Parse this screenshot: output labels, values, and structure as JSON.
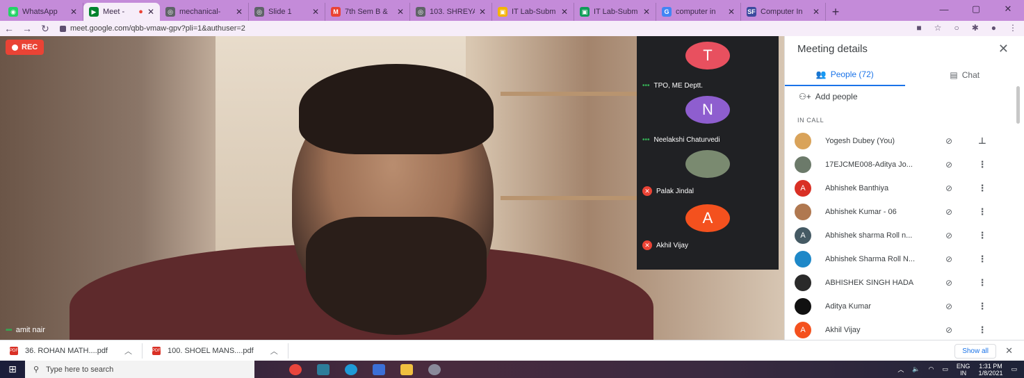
{
  "browser": {
    "tabs": [
      {
        "title": "WhatsApp",
        "color": "#25d366",
        "glyph": "◉"
      },
      {
        "title": "Meet - ",
        "color": "#00832d",
        "glyph": "▶",
        "active": true,
        "recording": true
      },
      {
        "title": "mechanical-",
        "color": "#5f6368",
        "glyph": "◎"
      },
      {
        "title": "Slide 1",
        "color": "#5f6368",
        "glyph": "◎"
      },
      {
        "title": "7th Sem B &",
        "color": "#ea4335",
        "glyph": "M"
      },
      {
        "title": "103. SHREYA",
        "color": "#5f6368",
        "glyph": "◎"
      },
      {
        "title": "IT Lab-Subm",
        "color": "#f4b400",
        "glyph": "▣"
      },
      {
        "title": "IT Lab-Subm",
        "color": "#0f9d58",
        "glyph": "▣"
      },
      {
        "title": "computer in",
        "color": "#4285f4",
        "glyph": "G"
      },
      {
        "title": "Computer In",
        "color": "#3c4a9e",
        "glyph": "SF"
      }
    ],
    "url": "meet.google.com/qbb-vmaw-gpv?pli=1&authuser=2"
  },
  "meet": {
    "rec_label": "REC",
    "main_speaker": "amit nair",
    "tiles": [
      {
        "name": "TPO, ME Deptt.",
        "initial": "T",
        "color": "#e8505f",
        "state": "talking"
      },
      {
        "name": "Neelakshi Chaturvedi",
        "initial": "N",
        "color": "#8e5ecf",
        "state": "talking"
      },
      {
        "name": "Palak Jindal",
        "initial": "",
        "color": "#7a8a70",
        "state": "muted"
      },
      {
        "name": "Akhil Vijay",
        "initial": "A",
        "color": "#f4511e",
        "state": "muted"
      }
    ]
  },
  "panel": {
    "title": "Meeting details",
    "tab_people": "People (72)",
    "tab_chat": "Chat",
    "add_people": "Add people",
    "in_call": "IN CALL",
    "people": [
      {
        "name": "Yogesh Dubey (You)",
        "initial": "",
        "color": "#d9a35a",
        "action": "pin"
      },
      {
        "name": "17EJCME008-Aditya Jo...",
        "initial": "",
        "color": "#6c7a6a",
        "action": "more"
      },
      {
        "name": "Abhishek Banthiya",
        "initial": "A",
        "color": "#d93025",
        "action": "more"
      },
      {
        "name": "Abhishek Kumar - 06",
        "initial": "",
        "color": "#b07850",
        "action": "more"
      },
      {
        "name": "Abhishek sharma Roll n...",
        "initial": "A",
        "color": "#455a64",
        "action": "more"
      },
      {
        "name": "Abhishek Sharma Roll N...",
        "initial": "",
        "color": "#1e88c8",
        "action": "more"
      },
      {
        "name": "ABHISHEK SINGH HADA",
        "initial": "",
        "color": "#2a2a2a",
        "action": "more"
      },
      {
        "name": "Aditya Kumar",
        "initial": "",
        "color": "#111111",
        "action": "more"
      },
      {
        "name": "Akhil Vijay",
        "initial": "A",
        "color": "#f4511e",
        "action": "more"
      }
    ]
  },
  "downloads": {
    "items": [
      "36. ROHAN MATH....pdf",
      "100. SHOEL MANS....pdf"
    ],
    "show_all": "Show all"
  },
  "taskbar": {
    "search_placeholder": "Type here to search",
    "lang": "ENG",
    "region": "IN",
    "time": "1:31 PM",
    "date": "1/8/2021"
  }
}
